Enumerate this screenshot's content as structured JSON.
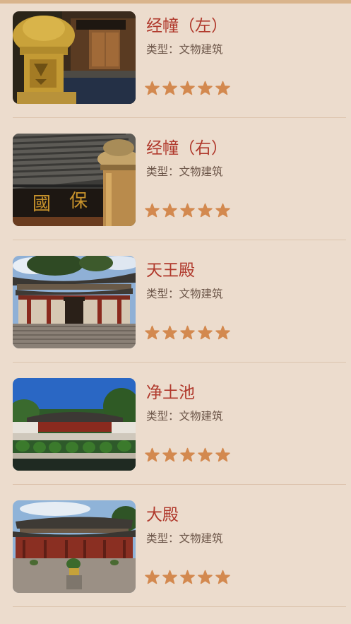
{
  "items": [
    {
      "title": "经幢（左）",
      "type_label": "类型：文物建筑",
      "rating": 5,
      "image_icon": "stone-pillar-photo"
    },
    {
      "title": "经幢（右）",
      "type_label": "类型：文物建筑",
      "rating": 5,
      "image_icon": "temple-plaque-photo"
    },
    {
      "title": "天王殿",
      "type_label": "类型：文物建筑",
      "rating": 5,
      "image_icon": "hall-photo"
    },
    {
      "title": "净土池",
      "type_label": "类型：文物建筑",
      "rating": 5,
      "image_icon": "pond-photo"
    },
    {
      "title": "大殿",
      "type_label": "类型：文物建筑",
      "rating": 5,
      "image_icon": "main-hall-photo"
    }
  ],
  "colors": {
    "background": "#ecdccd",
    "title": "#b0392c",
    "type_text": "#6b5548",
    "star": "#d3894f",
    "divider": "#dcc3ad"
  }
}
